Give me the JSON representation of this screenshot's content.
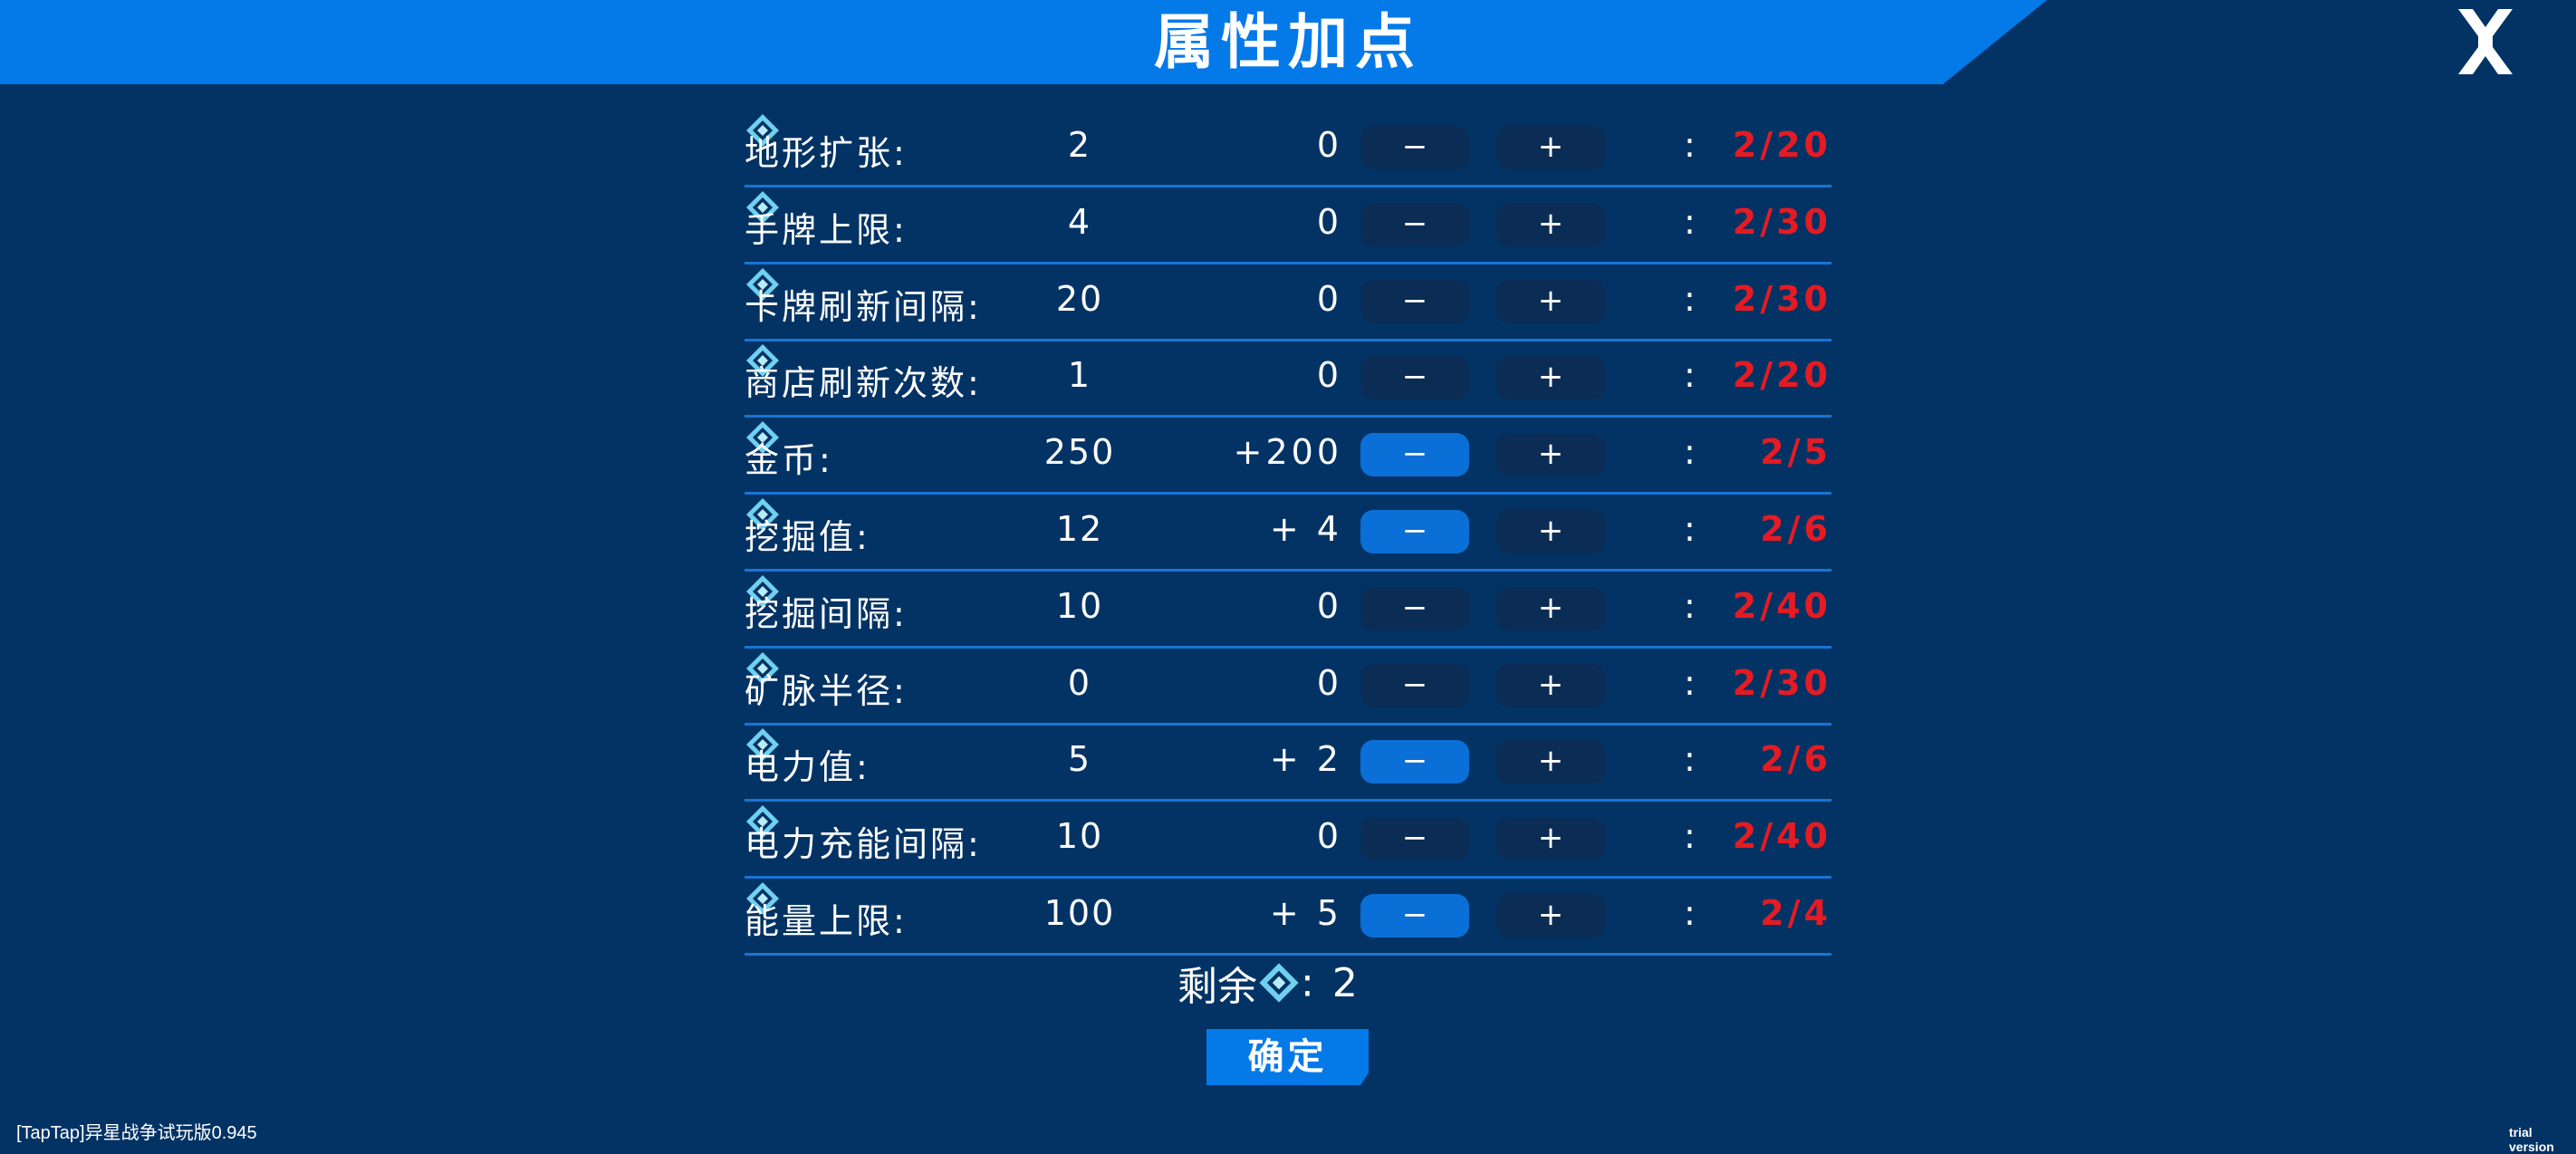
{
  "header": {
    "title": "属性加点"
  },
  "icons": {
    "close": "close-icon",
    "currency": "crystal-icon"
  },
  "colors": {
    "background": "#033364",
    "banner": "#0479e8",
    "cost": "#e51b23",
    "button": "#0a2c55",
    "button_active": "#0a6fd6",
    "crystal": "#6fd0ef"
  },
  "controls": {
    "minus_label": "−",
    "plus_label": "+",
    "colon": ":"
  },
  "attributes": [
    {
      "label": "地形扩张:",
      "value": "2",
      "added": "0",
      "cost": "2/20",
      "minus_active": false
    },
    {
      "label": "手牌上限:",
      "value": "4",
      "added": "0",
      "cost": "2/30",
      "minus_active": false
    },
    {
      "label": "卡牌刷新间隔:",
      "value": "20",
      "added": "0",
      "cost": "2/30",
      "minus_active": false
    },
    {
      "label": "商店刷新次数:",
      "value": "1",
      "added": "0",
      "cost": "2/20",
      "minus_active": false
    },
    {
      "label": "金币:",
      "value": "250",
      "added": "+200",
      "cost": "2/5",
      "minus_active": true
    },
    {
      "label": "挖掘值:",
      "value": "12",
      "added": "+ 4",
      "cost": "2/6",
      "minus_active": true
    },
    {
      "label": "挖掘间隔:",
      "value": "10",
      "added": "0",
      "cost": "2/40",
      "minus_active": false
    },
    {
      "label": "矿脉半径:",
      "value": "0",
      "added": "0",
      "cost": "2/30",
      "minus_active": false
    },
    {
      "label": "电力值:",
      "value": "5",
      "added": "+ 2",
      "cost": "2/6",
      "minus_active": true
    },
    {
      "label": "电力充能间隔:",
      "value": "10",
      "added": "0",
      "cost": "2/40",
      "minus_active": false
    },
    {
      "label": "能量上限:",
      "value": "100",
      "added": "+ 5",
      "cost": "2/4",
      "minus_active": true
    }
  ],
  "remaining": {
    "label": "剩余",
    "colon": ":",
    "value": "2"
  },
  "confirm": {
    "label": "确定"
  },
  "footer": {
    "version": "[TapTap]异星战争试玩版0.945",
    "trial": "trial version"
  }
}
